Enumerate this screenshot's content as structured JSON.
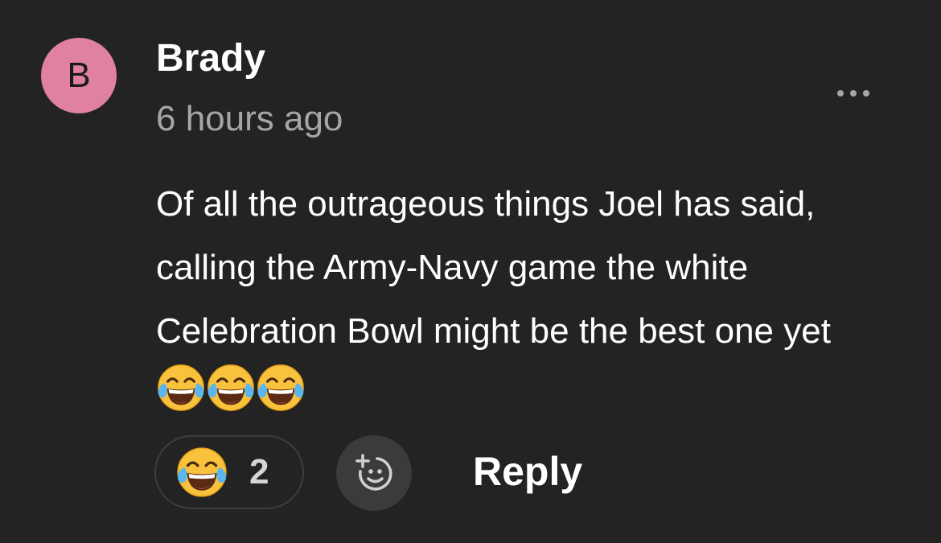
{
  "comment": {
    "avatar": {
      "initial": "B",
      "color": "#e0829f"
    },
    "author": "Brady",
    "timestamp": "6 hours ago",
    "text": "Of all the outrageous things Joel has said, calling the Army-Navy game the white Celebration Bowl might be the best one yet",
    "text_emojis": [
      "face-with-tears-of-joy",
      "face-with-tears-of-joy",
      "face-with-tears-of-joy"
    ],
    "more_icon": "more-horizontal-icon",
    "reaction": {
      "emoji": "face-with-tears-of-joy",
      "count": "2"
    },
    "add_reaction_icon": "add-reaction-icon",
    "reply_label": "Reply"
  }
}
